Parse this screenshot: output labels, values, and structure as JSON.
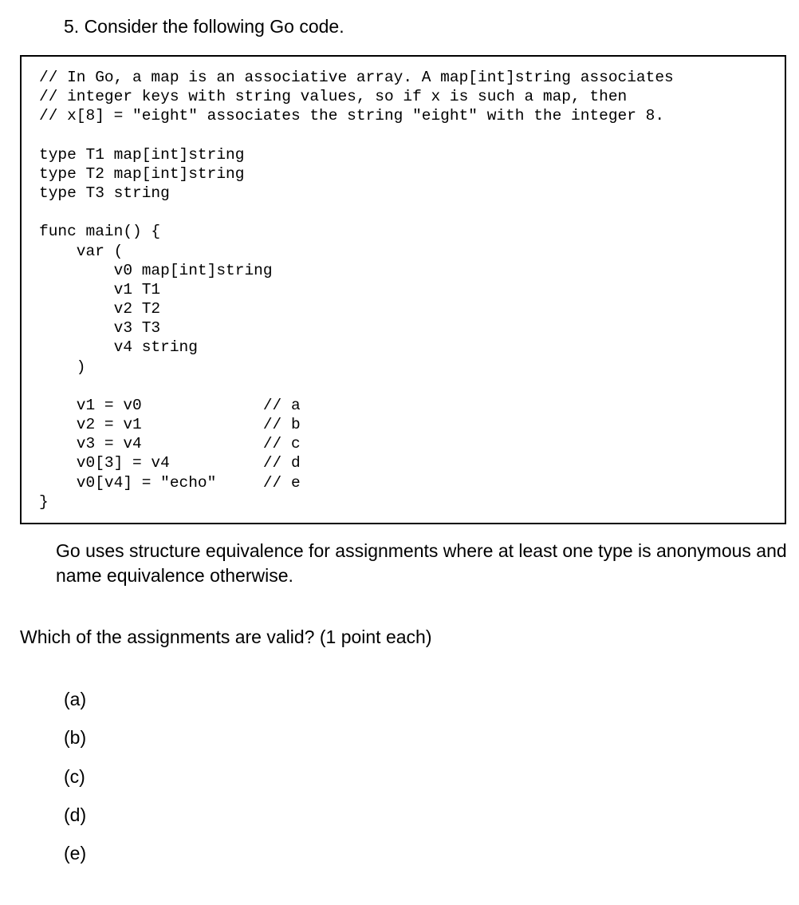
{
  "title": "5. Consider the following Go code.",
  "code": "// In Go, a map is an associative array. A map[int]string associates\n// integer keys with string values, so if x is such a map, then\n// x[8] = \"eight\" associates the string \"eight\" with the integer 8.\n\ntype T1 map[int]string\ntype T2 map[int]string\ntype T3 string\n\nfunc main() {\n    var (\n        v0 map[int]string\n        v1 T1\n        v2 T2\n        v3 T3\n        v4 string\n    )\n\n    v1 = v0             // a\n    v2 = v1             // b\n    v3 = v4             // c\n    v0[3] = v4          // d\n    v0[v4] = \"echo\"     // e\n}",
  "explain": "Go uses structure equivalence for assignments where at least one type is anonymous and name equivalence otherwise.",
  "question": "Which of the assignments are valid? (1 point each)",
  "options": {
    "a": "(a)",
    "b": "(b)",
    "c": "(c)",
    "d": "(d)",
    "e": "(e)"
  }
}
